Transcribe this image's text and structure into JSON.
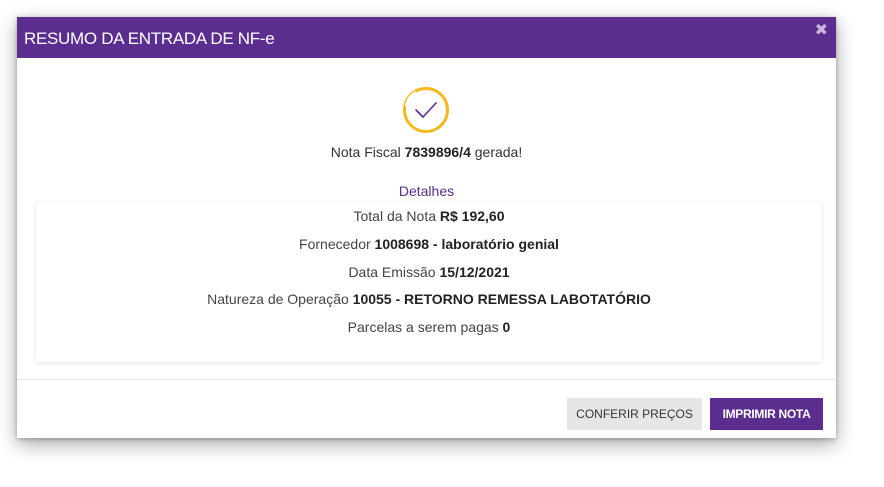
{
  "colors": {
    "header_bg": "#5b2d8e",
    "accent": "#5b2d8e",
    "check_ring": "#f5b91e",
    "secondary_button_bg": "#e6e6e6"
  },
  "modal": {
    "title": "RESUMO DA ENTRADA DE NF-e",
    "close_icon": "close-icon"
  },
  "status": {
    "icon": "check-circle-icon",
    "prefix": "Nota Fiscal",
    "number": "7839896/4",
    "suffix": "gerada!"
  },
  "details": {
    "title": "Detalhes",
    "rows": [
      {
        "label": "Total da Nota",
        "value": "R$ 192,60"
      },
      {
        "label": "Fornecedor",
        "value": "1008698 - laboratório genial"
      },
      {
        "label": "Data Emissão",
        "value": "15/12/2021"
      },
      {
        "label": "Natureza de Operação",
        "value": "10055 - RETORNO REMESSA LABOTATÓRIO"
      },
      {
        "label": "Parcelas a serem pagas",
        "value": "0"
      }
    ]
  },
  "footer": {
    "check_prices_label": "CONFERIR PREÇOS",
    "print_label": "IMPRIMIR NOTA"
  }
}
